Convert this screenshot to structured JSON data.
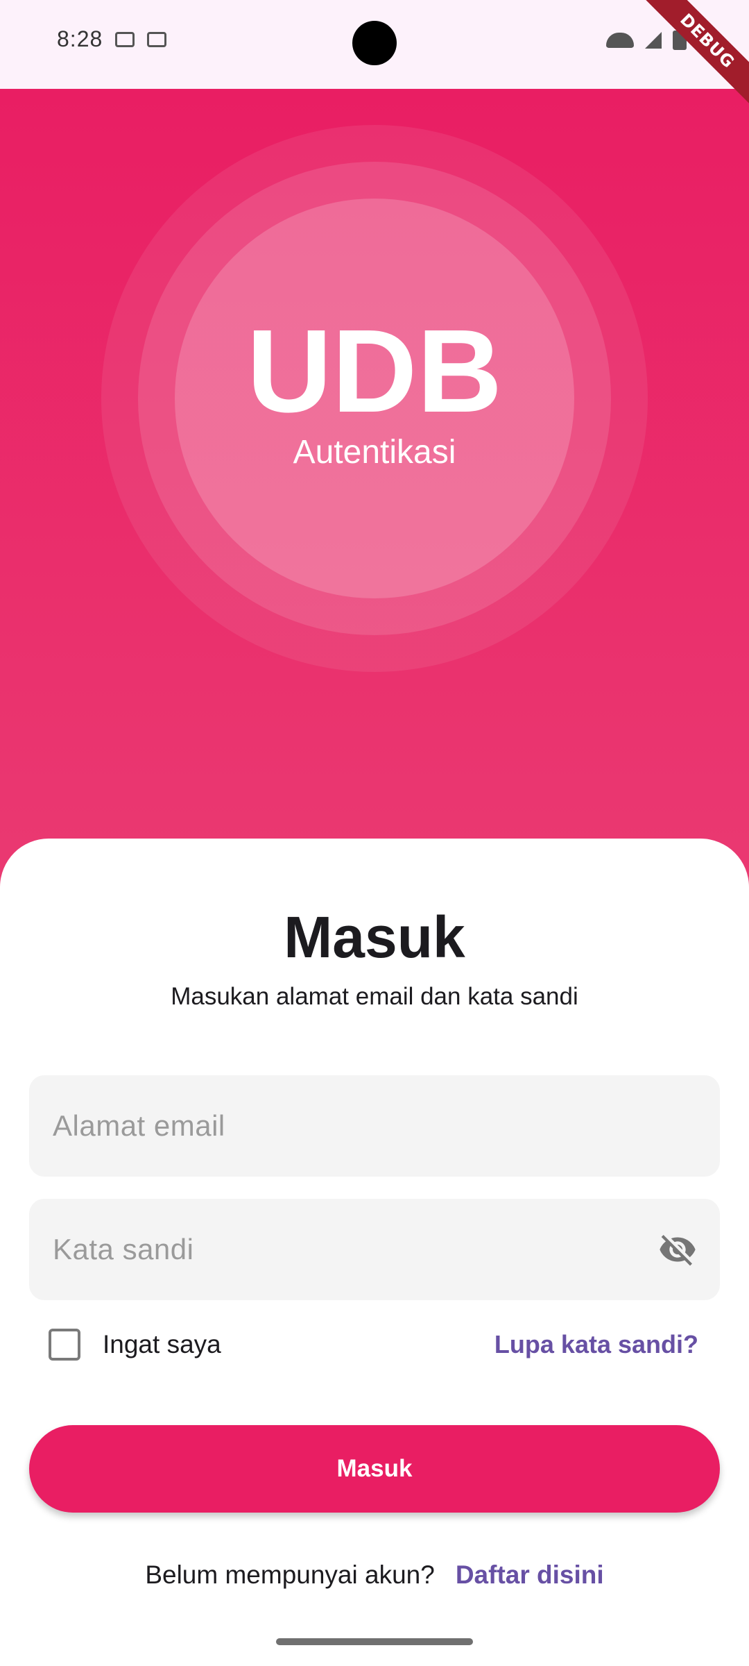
{
  "status_bar": {
    "time": "8:28",
    "debug_label": "DEBUG"
  },
  "hero": {
    "logo": "UDB",
    "subtitle": "Autentikasi"
  },
  "login": {
    "title": "Masuk",
    "subtitle": "Masukan alamat email dan kata sandi",
    "email_placeholder": "Alamat email",
    "password_placeholder": "Kata sandi",
    "remember_label": "Ingat saya",
    "remember_checked": false,
    "forgot_link": "Lupa kata sandi?",
    "submit_label": "Masuk",
    "signup_prompt": "Belum mempunyai akun?",
    "signup_link": "Daftar disini"
  },
  "colors": {
    "primary": "#e91e63",
    "link": "#6750a4",
    "field_background": "#f4f4f4"
  },
  "icons": {
    "password_toggle": "visibility-off-icon"
  }
}
